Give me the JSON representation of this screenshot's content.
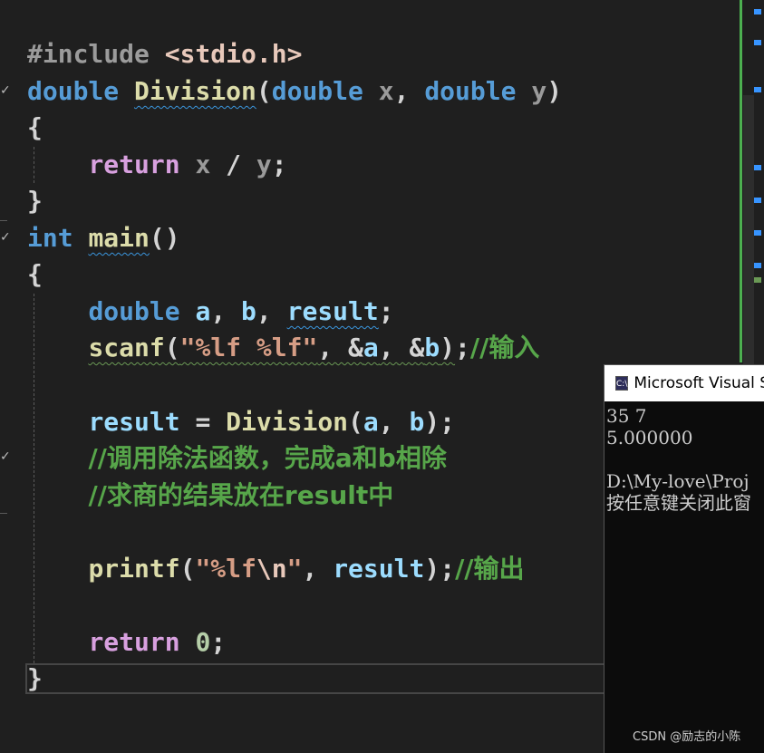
{
  "editor": {
    "line_include_directive": "#include",
    "line_include_header": "<stdio.h>",
    "kw_double": "double",
    "kw_int": "int",
    "kw_return": "return",
    "fn_division": "Division",
    "fn_main": "main",
    "fn_scanf": "scanf",
    "fn_printf": "printf",
    "param_x": "x",
    "param_y": "y",
    "var_a": "a",
    "var_b": "b",
    "var_result": "result",
    "str_scanf": "\"%lf %lf\"",
    "str_printf_open": "\"%lf",
    "str_printf_escape": "\\n",
    "str_printf_close": "\"",
    "num_zero": "0",
    "comment_input": "//输入",
    "comment_call": "//调用除法函数，完成a和b相除",
    "comment_quotient": "//求商的结果放在result中",
    "comment_output": "//输出"
  },
  "console": {
    "title": "Microsoft Visual S",
    "icon_text": "C:\\",
    "output_line1": "35 7",
    "output_line2": "5.000000",
    "output_line3": "",
    "output_line4": "D:\\My-love\\Proj",
    "output_line5": "按任意键关闭此窗"
  },
  "watermark": "CSDN @励志的小陈",
  "colors": {
    "background": "#1f1f1f",
    "keyword": "#569cd6",
    "control": "#d8a0df",
    "function": "#dcdcaa",
    "variable": "#9cdcfe",
    "string": "#d69d85",
    "comment": "#57a64a",
    "number": "#b5cea8"
  }
}
